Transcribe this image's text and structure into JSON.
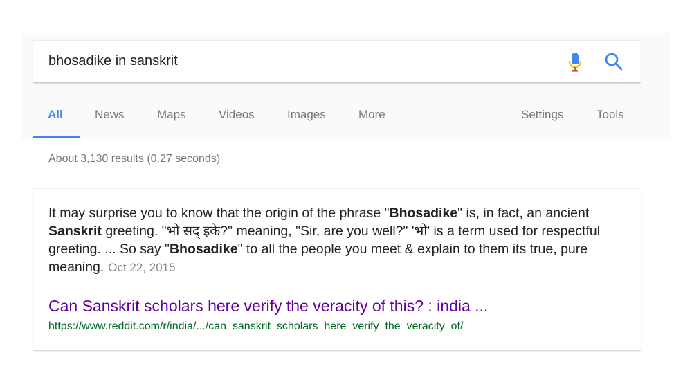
{
  "search": {
    "query": "bhosadike in sanskrit"
  },
  "icons": {
    "mic": "microphone-icon",
    "search": "search-icon"
  },
  "tabs": [
    {
      "label": "All",
      "active": true
    },
    {
      "label": "News"
    },
    {
      "label": "Maps"
    },
    {
      "label": "Videos"
    },
    {
      "label": "Images"
    },
    {
      "label": "More"
    },
    {
      "label": "Settings"
    },
    {
      "label": "Tools"
    }
  ],
  "results": {
    "stats": "About 3,130 results (0.27 seconds)"
  },
  "featured": {
    "snippet_parts": [
      "It may surprise you to know that the origin of the phrase \"",
      "Bhosadike",
      "\" is, in fact, an ancient ",
      "Sanskrit",
      " greeting. \"भो सद् इके?\" meaning, \"Sir, are you well?\" 'भो' is a term used for respectful greeting. ... So say \"",
      "Bhosadike",
      "\" to all the people you meet & explain to them its true, pure meaning."
    ],
    "date": "Oct 22, 2015",
    "title": "Can Sanskrit scholars here verify the veracity of this? : india ...",
    "url": "https://www.reddit.com/r/india/.../can_sanskrit_scholars_here_verify_the_veracity_of/"
  },
  "colors": {
    "accent": "#4285f4",
    "visited_link": "#660099",
    "url_green": "#006621"
  }
}
